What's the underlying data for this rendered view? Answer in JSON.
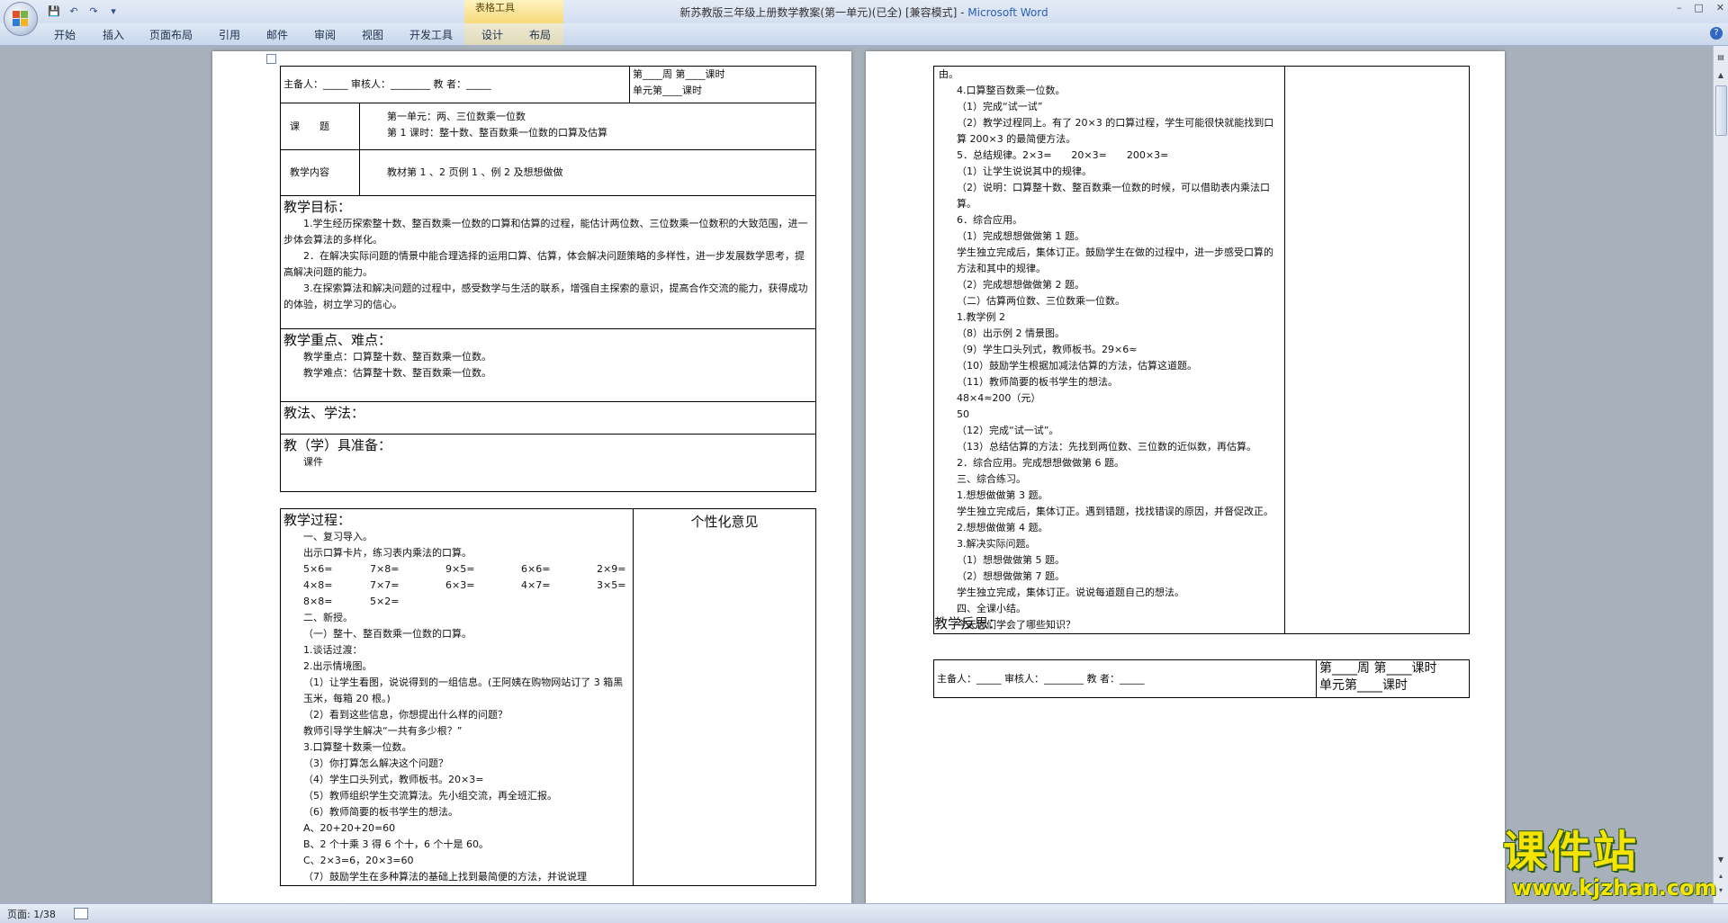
{
  "window": {
    "title": "新苏教版三年级上册数学教案(第一单元)(已全) [兼容模式]",
    "app_name": "Microsoft Word",
    "contextual_group": "表格工具"
  },
  "ribbon": {
    "tabs": [
      "开始",
      "插入",
      "页面布局",
      "引用",
      "邮件",
      "审阅",
      "视图",
      "开发工具",
      "设计",
      "布局"
    ]
  },
  "status": {
    "page": "页面: 1/38"
  },
  "watermark": {
    "cn": "课件站",
    "url": "www.kjzhan.com"
  },
  "page1": {
    "header": {
      "preparer": "主备人：_____  审核人：________   教   者：_____",
      "week": "第____周 第____课时",
      "unit": "单元第____课时"
    },
    "topic_label": "课　　题",
    "topic_lines": [
      "第一单元：两、三位数乘一位数",
      "第 1 课时：整十数、整百数乘一位数的口算及估算"
    ],
    "content_label": "教学内容",
    "content_value": "教材第 1 、2 页例 1 、例 2 及想想做做",
    "goals_title": "教学目标：",
    "goals": [
      "1.学生经历探索整十数、整百数乘一位数的口算和估算的过程，能估计两位数、三位数乘一位数积的大致范围，进一步体会算法的多样化。",
      "2．在解决实际问题的情景中能合理选择的运用口算、估算，体会解决问题策略的多样性，进一步发展数学思考，提高解决问题的能力。",
      "3.在探索算法和解决问题的过程中，感受数学与生活的联系，增强自主探索的意识，提高合作交流的能力，获得成功的体验，树立学习的信心。"
    ],
    "keypoints_title": "教学重点、难点：",
    "keypoints": [
      "教学重点：口算整十数、整百数乘一位数。",
      "教学难点：估算整十数、整百数乘一位数。"
    ],
    "method_title": "教法、学法：",
    "tools_title": "教（学）具准备：",
    "tools_value": "课件",
    "process_title": "教学过程：",
    "personal_title": "个性化意见",
    "process_pre": [
      "一、复习导入。",
      "出示口算卡片，练习表内乘法的口算。"
    ],
    "oral_rows": [
      [
        "5×6=",
        "7×8=",
        "9×5=",
        "6×6=",
        "2×9="
      ],
      [
        "4×8=",
        "7×7=",
        "6×3=",
        "4×7=",
        "3×5="
      ],
      [
        "8×8=",
        "5×2=",
        "",
        "",
        ""
      ]
    ],
    "process_lines": [
      "二、新授。",
      "（一）整十、整百数乘一位数的口算。",
      "1.谈话过渡：",
      "2.出示情境图。",
      "（1）让学生看图，说说得到的一组信息。(王阿姨在购物网站订了 3 箱黑玉米，每箱 20 根。)",
      "（2）看到这些信息，你想提出什么样的问题？",
      "教师引导学生解决“一共有多少根？”",
      "3.口算整十数乘一位数。",
      "（3）你打算怎么解决这个问题？",
      "（4）学生口头列式，教师板书。20×3=",
      "（5）教师组织学生交流算法。先小组交流，再全班汇报。",
      "（6）教师简要的板书学生的想法。",
      "A、20+20+20=60",
      "B、2 个十乘 3 得 6 个十，6 个十是 60。",
      "C、2×3=6，20×3=60",
      "（7）鼓励学生在多种算法的基础上找到最简便的方法，并说说理"
    ]
  },
  "page2": {
    "lines": [
      "由。",
      "4.口算整百数乘一位数。",
      "（1）完成“试一试”",
      "（2）教学过程同上。有了 20×3 的口算过程，学生可能很快就能找到口算 200×3 的最简便方法。",
      "5．总结规律。2×3=　　20×3=　　200×3=",
      "（1）让学生说说其中的规律。",
      "（2）说明：口算整十数、整百数乘一位数的时候，可以借助表内乘法口算。",
      "6．综合应用。",
      "（1）完成想想做做第 1 题。",
      "学生独立完成后，集体订正。鼓励学生在做的过程中，进一步感受口算的方法和其中的规律。",
      "（2）完成想想做做第 2 题。",
      "（二）估算两位数、三位数乘一位数。",
      "1.教学例 2",
      "（8）出示例 2 情景图。",
      "（9）学生口头列式，教师板书。29×6≈",
      "（10）鼓励学生根据加减法估算的方法，估算这道题。",
      "（11）教师简要的板书学生的想法。",
      "48×4≈200（元）",
      "50",
      "（12）完成“试一试”。",
      "（13）总结估算的方法：先找到两位数、三位数的近似数，再估算。",
      "2．综合应用。完成想想做做第 6 题。",
      "三、综合练习。",
      "1.想想做做第 3 题。",
      "学生独立完成后，集体订正。遇到错题，找找错误的原因，并督促改正。",
      "2.想想做做第 4 题。",
      "3.解决实际问题。",
      "（1）想想做做第 5 题。",
      "（2）想想做做第 7 题。",
      "学生独立完成，集体订正。说说每道题自己的想法。",
      "四、全课小结。",
      "今天你们学会了哪些知识？"
    ],
    "reflection_title": "教学反思：",
    "footer": {
      "preparer": "主备人：_____  审核人：________   教   者：_____",
      "week": "第____周 第____课时",
      "unit": "单元第____课时"
    }
  }
}
